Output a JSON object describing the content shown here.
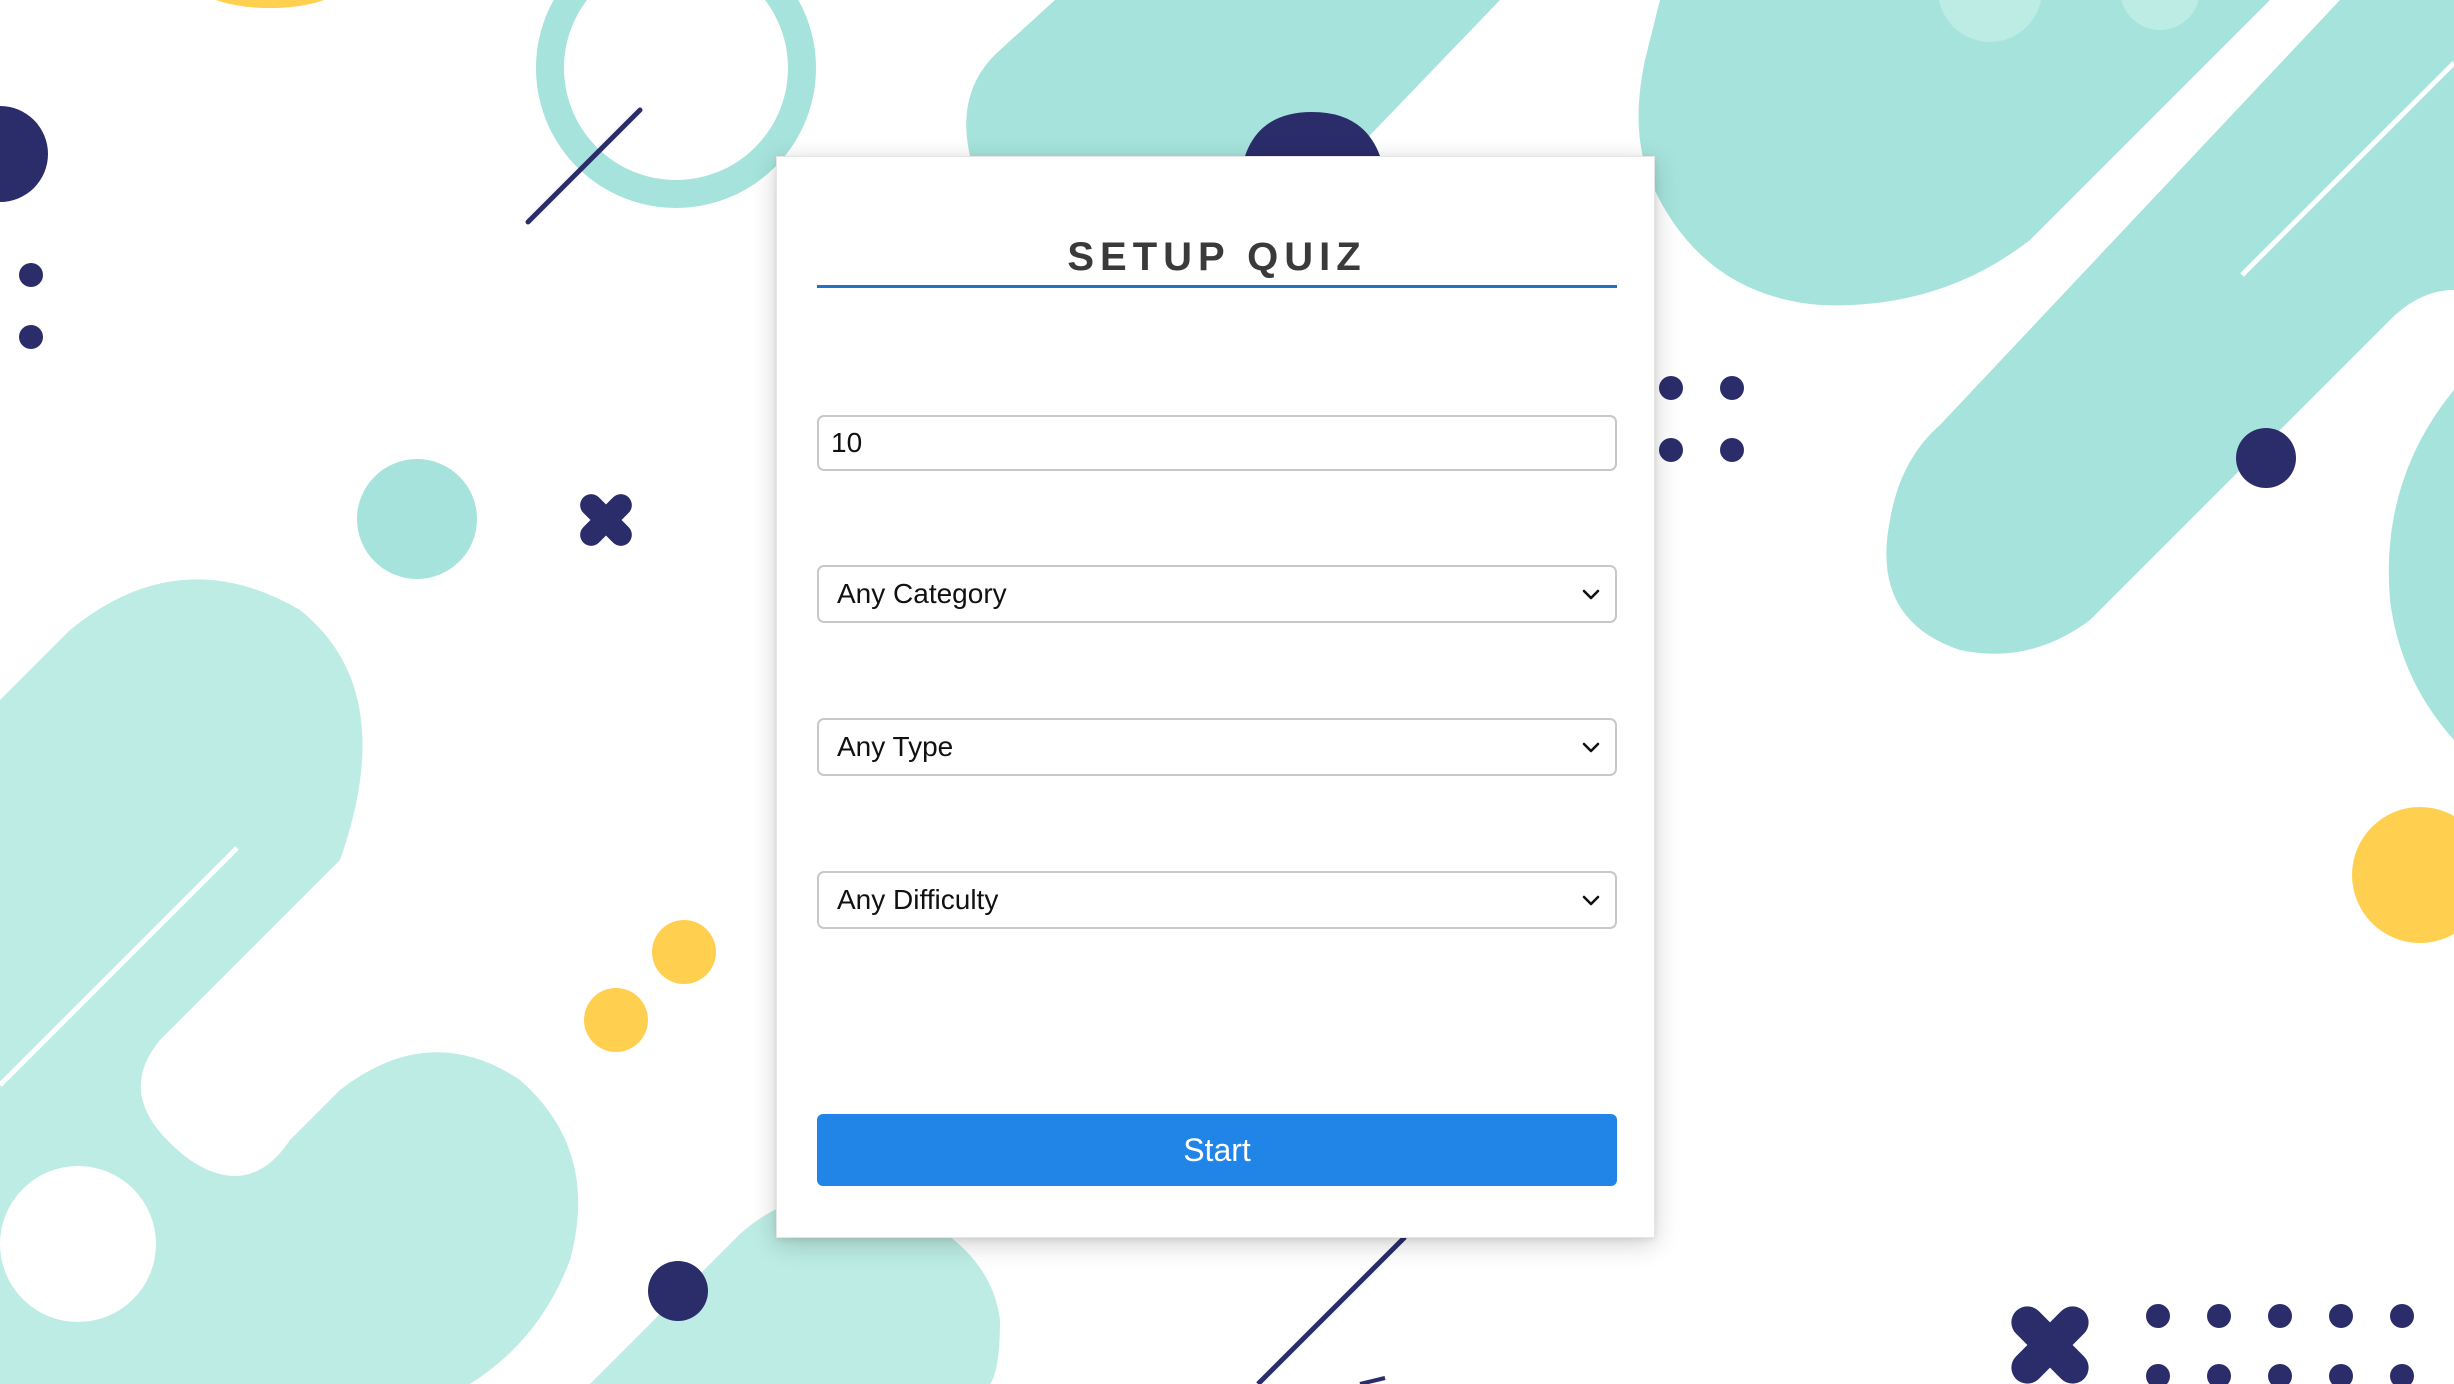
{
  "quiz": {
    "title": "SETUP QUIZ",
    "amount_value": "10",
    "category_selected": "Any Category",
    "type_selected": "Any Type",
    "difficulty_selected": "Any Difficulty",
    "start_label": "Start"
  },
  "colors": {
    "accent_blue": "#2185e8",
    "title_rule": "#1e72c8",
    "mint": "#a6e3dc",
    "navy": "#2b2d6b",
    "yellow": "#ffd04f"
  },
  "icons": {
    "select_chevron": "chevron-down-icon"
  }
}
